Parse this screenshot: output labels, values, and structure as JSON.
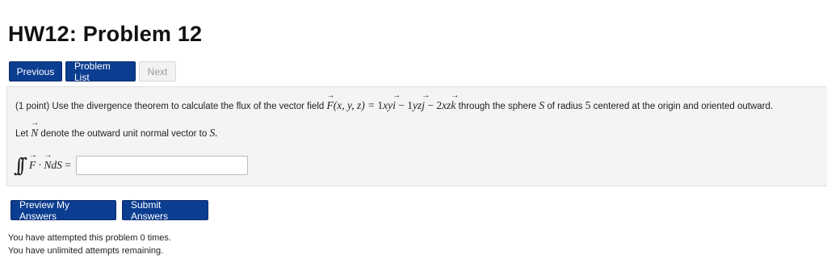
{
  "page": {
    "title": "HW12: Problem 12"
  },
  "nav": {
    "previous": "Previous",
    "problem_list": "Problem List",
    "next": "Next"
  },
  "problem": {
    "points": "(1 point)",
    "text_pre": "Use the divergence theorem to calculate the flux of the vector field",
    "field_lhs": "F(x, y, z) =",
    "field_rhs": "1xyi − 1yzj − 2xzk",
    "text_post": "through the sphere",
    "sphere_symbol": "S",
    "text_radius": "of radius",
    "radius": "5",
    "text_end": "centered at the origin and oriented outward.",
    "let_pre": "Let",
    "normal_symbol": "N",
    "let_mid": "denote the outward unit normal vector to",
    "let_end": "S.",
    "integral_expr": "F · N dS =",
    "answer_value": ""
  },
  "actions": {
    "preview": "Preview My Answers",
    "submit": "Submit Answers"
  },
  "status": {
    "attempts": "You have attempted this problem 0 times.",
    "remaining": "You have unlimited attempts remaining."
  }
}
